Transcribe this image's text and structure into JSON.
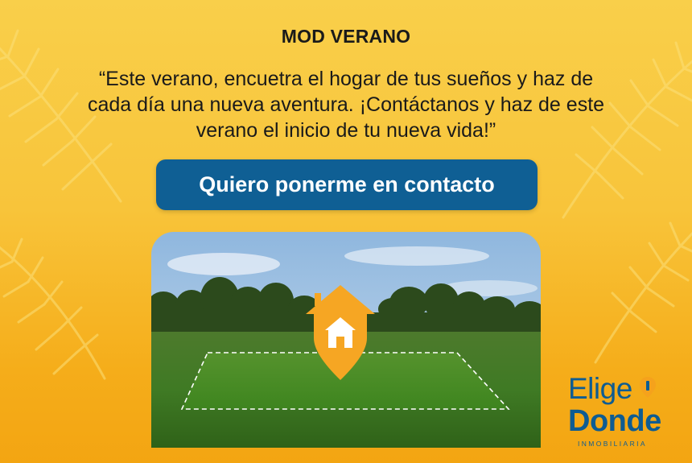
{
  "banner": {
    "title": "MOD VERANO",
    "quote_line1": "“Este verano, encuetra el hogar de tus sueños y haz de",
    "quote_line2": "cada día una nueva aventura. ¡Contáctanos y haz de este",
    "quote_line3": "verano el inicio de tu nueva vida!”",
    "cta_label": "Quiero ponerme en contacto"
  },
  "image": {
    "subject": "land-plot-photo",
    "marker_icon": "house-location-pin-icon"
  },
  "logo": {
    "line1": "Elige",
    "line2": "Donde",
    "line3": "INMOBILIARIA",
    "pin_icon": "location-pin-icon"
  },
  "colors": {
    "background_top": "#f9cf4a",
    "background_bottom": "#f3a512",
    "button": "#0f5f94",
    "brand_blue": "#0e5c92",
    "pin_orange": "#f6a623"
  }
}
